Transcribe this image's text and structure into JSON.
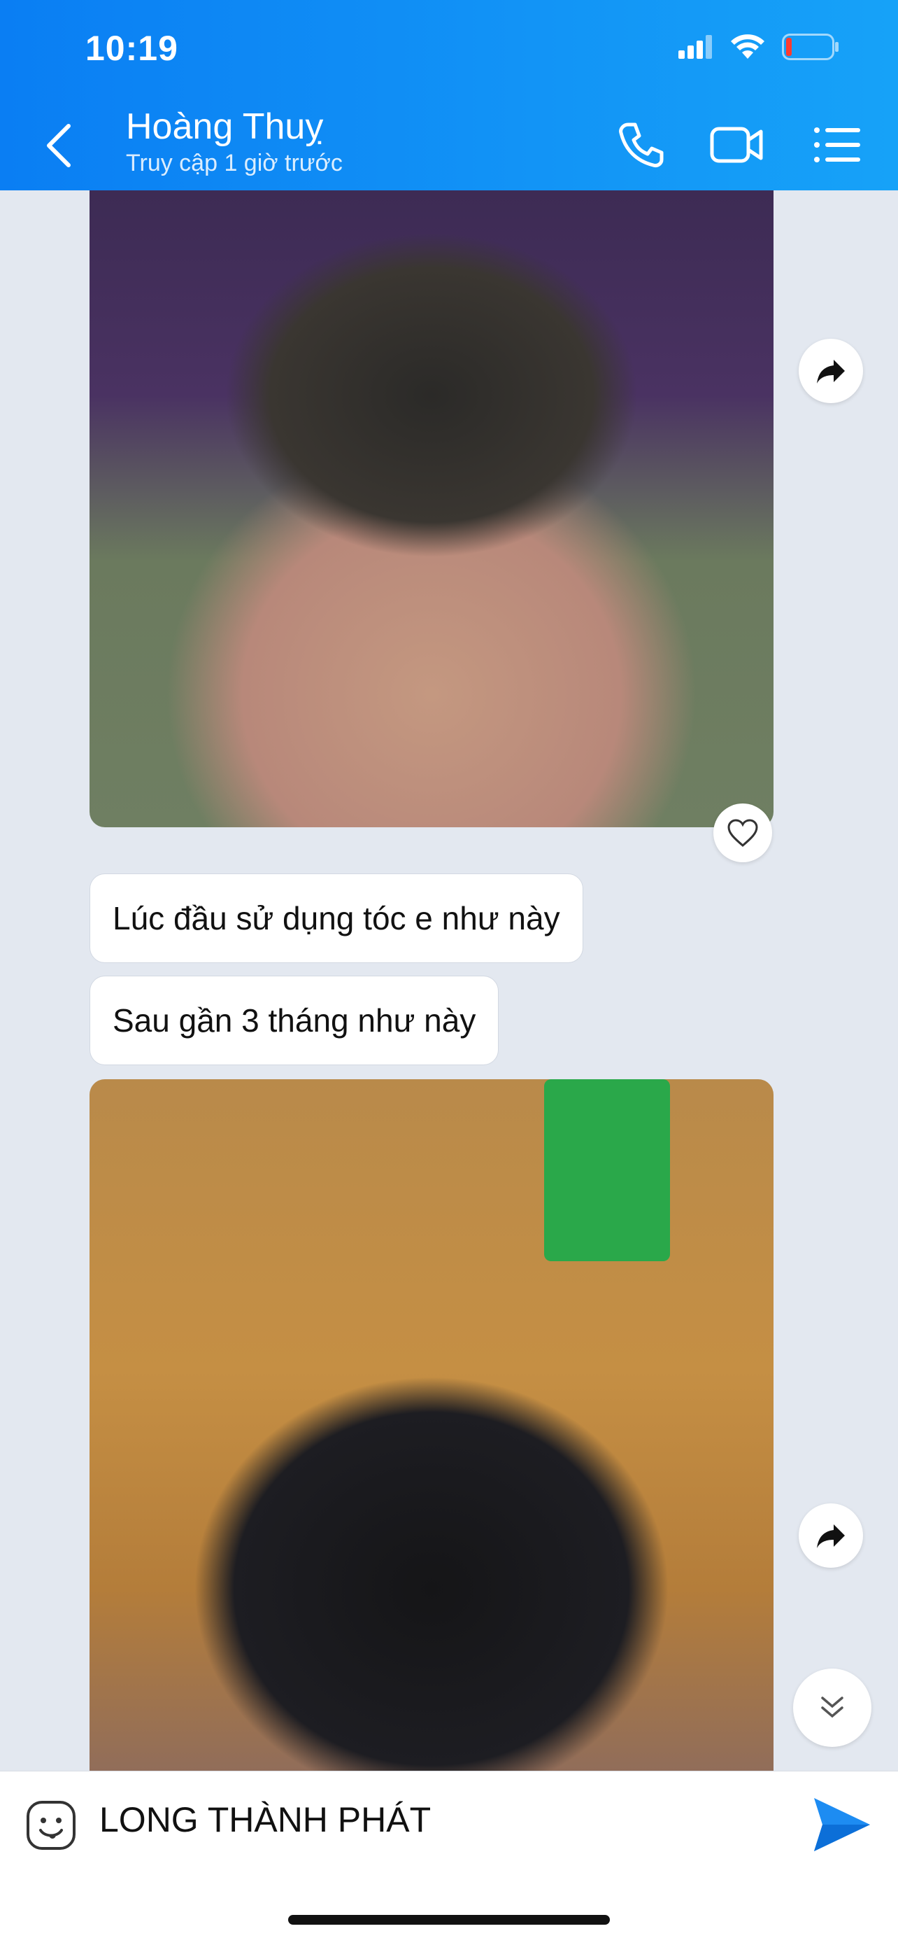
{
  "status": {
    "time": "10:19"
  },
  "header": {
    "title": "Hoàng Thuỵ",
    "subtitle": "Truy cập 1 giờ trước"
  },
  "messages": [
    {
      "type": "image",
      "icon": "hair-photo"
    },
    {
      "type": "text",
      "text": "Lúc đầu sử dụng tóc e như này"
    },
    {
      "type": "text",
      "text": "Sau gần 3 tháng như này"
    },
    {
      "type": "image",
      "icon": "hair-photo"
    }
  ],
  "composer": {
    "value": "LONG THÀNH PHÁT"
  },
  "colors": {
    "header": "#0a7ef3",
    "send": "#1d8cf2",
    "chat_bg": "#e3e8f0"
  }
}
